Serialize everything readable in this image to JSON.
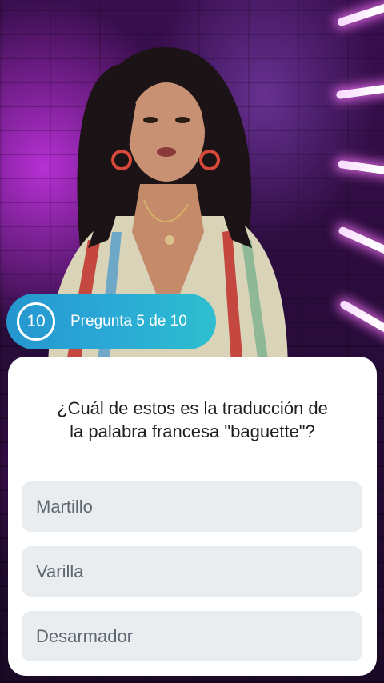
{
  "counter": {
    "number": "10",
    "label": "Pregunta 5 de 10",
    "accent_colors": [
      "#2596cf",
      "#2ebfcf"
    ]
  },
  "question": {
    "line1": "¿Cuál de estos es la traducción de",
    "line2": "la palabra francesa \"baguette\"?"
  },
  "answers": [
    {
      "label": "Martillo"
    },
    {
      "label": "Varilla"
    },
    {
      "label": "Desarmador"
    }
  ],
  "background": {
    "icon": "presenter-video-frame"
  }
}
